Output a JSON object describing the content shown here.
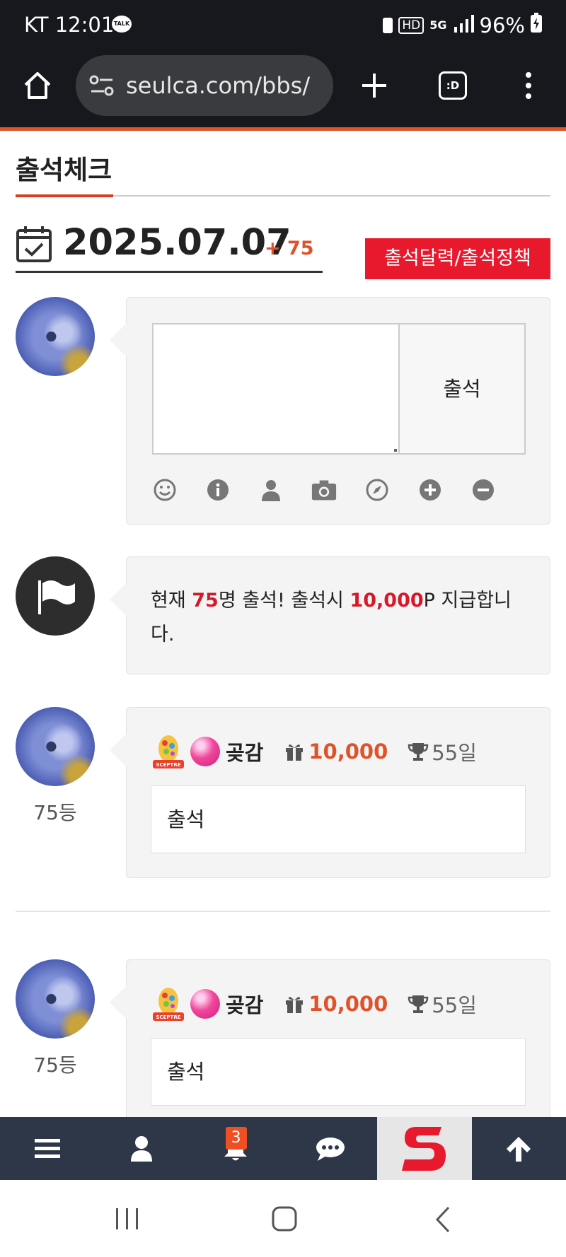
{
  "status_bar": {
    "carrier_time": "KT 12:01",
    "talk_icon_text": "TALK",
    "network_hd": "HD",
    "network_5g": "5G",
    "battery": "96%"
  },
  "browser": {
    "url": "seulca.com/bbs/",
    "tabs_label": ":D"
  },
  "page": {
    "title": "출석체크",
    "date": "2025.07.07",
    "today_count": "+ 75",
    "calendar_button": "출석달력/출석정책"
  },
  "attendance_form": {
    "textarea_value": "",
    "submit_label": "출석",
    "toolbar_icons": [
      "smile-icon",
      "info-icon",
      "user-icon",
      "camera-icon",
      "compass-icon",
      "plus-circle-icon",
      "minus-circle-icon"
    ]
  },
  "notice": {
    "prefix": "현재 ",
    "count": "75",
    "middle": "명 출석! 출석시 ",
    "points": "10,000",
    "suffix": "P 지급합니다."
  },
  "entries": [
    {
      "rank": "75등",
      "badge_text": "SCEPTRE",
      "nickname": "곶감",
      "points": "10,000",
      "days": "55일",
      "message": "출석"
    },
    {
      "rank": "75등",
      "badge_text": "SCEPTRE",
      "nickname": "곶감",
      "points": "10,000",
      "days": "55일",
      "message": "출석"
    }
  ],
  "bottom_nav": {
    "notification_count": "3",
    "items": [
      "menu-icon",
      "user-icon",
      "bell-icon",
      "chat-icon",
      "site-logo",
      "arrow-up-icon"
    ]
  },
  "colors": {
    "accent": "#e0522a",
    "red_button": "#e8192c",
    "nav_bg": "#2e3748",
    "dark_bar": "#16181d"
  }
}
